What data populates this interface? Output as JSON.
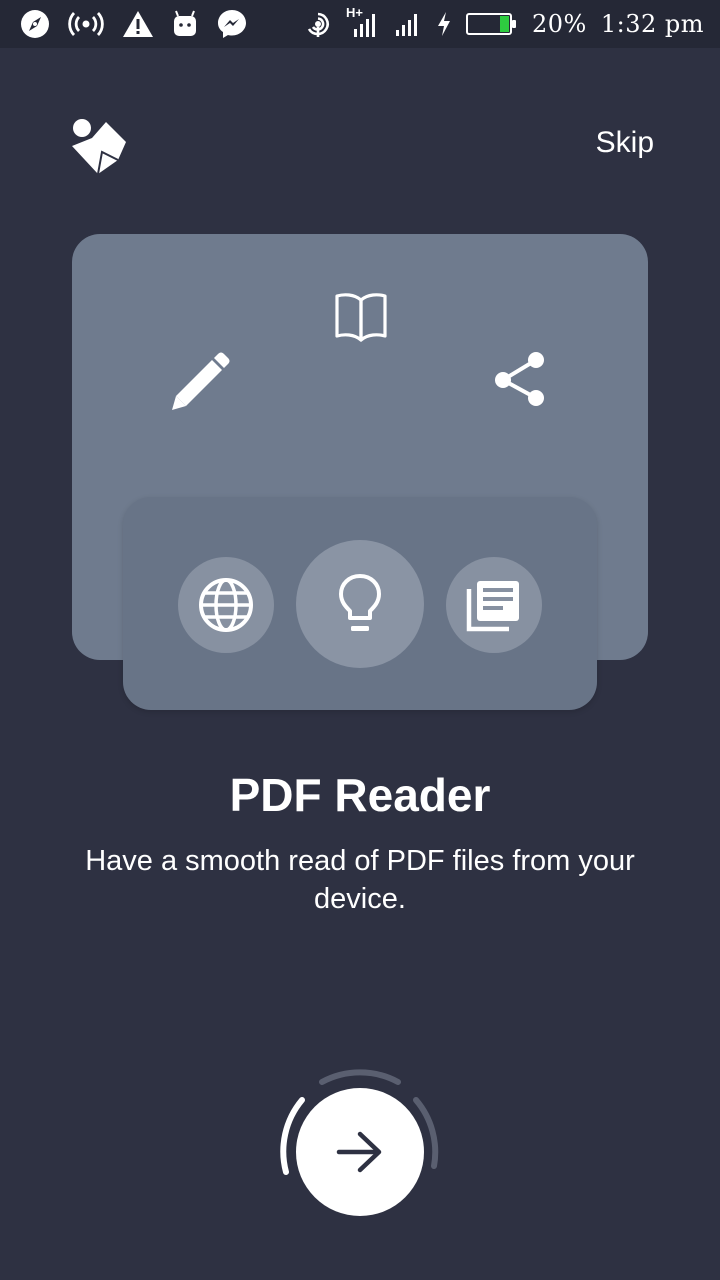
{
  "status_bar": {
    "icons": [
      "compass-icon",
      "hotspot-icon",
      "warning-icon",
      "android-icon",
      "messenger-icon",
      "wifi-calling-icon",
      "signal-icon",
      "signal-icon",
      "charging-icon",
      "battery-icon"
    ],
    "network": "H+",
    "battery_percent": "20%",
    "battery_level": 0.2,
    "time": "1:32 pm"
  },
  "header": {
    "skip_label": "Skip"
  },
  "illustration": {
    "top_icons": [
      "pencil-icon",
      "book-icon",
      "share-icon"
    ],
    "bottom_icons": [
      "globe-icon",
      "lightbulb-icon",
      "news-icon"
    ]
  },
  "onboarding": {
    "title": "PDF Reader",
    "description": "Have a smooth read of PDF files from your device."
  },
  "next_button": {
    "icon": "arrow-right-icon"
  },
  "colors": {
    "background": "#2e3142",
    "card_back": "#6f7b8e",
    "card_front": "#687487",
    "accent": "#ffffff"
  }
}
